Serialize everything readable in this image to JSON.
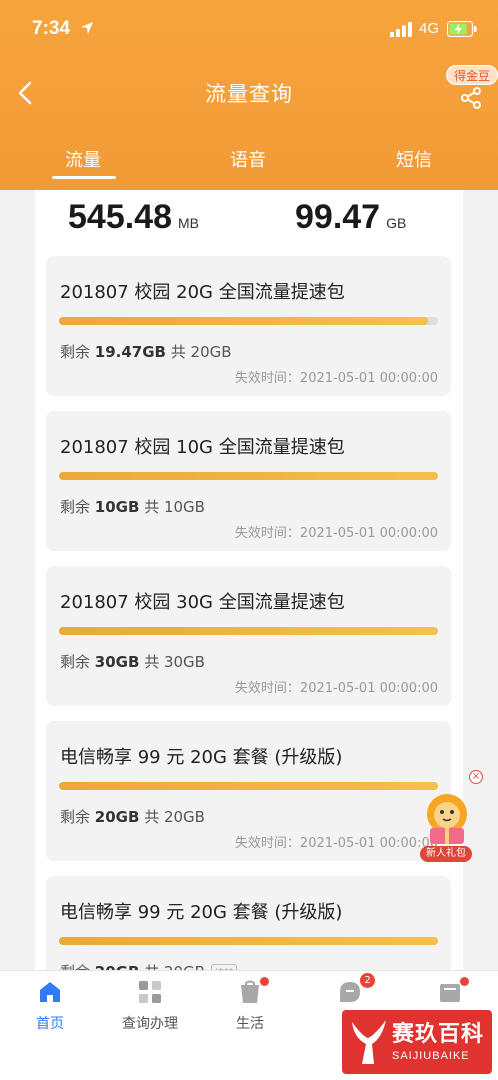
{
  "status_bar": {
    "time": "7:34",
    "network": "4G"
  },
  "nav": {
    "title": "流量查询",
    "badge": "得金豆"
  },
  "tabs": [
    {
      "label": "流量",
      "active": true
    },
    {
      "label": "语音",
      "active": false
    },
    {
      "label": "短信",
      "active": false
    }
  ],
  "totals": {
    "used": {
      "value": "545.48",
      "unit": "MB"
    },
    "remaining": {
      "value": "99.47",
      "unit": "GB"
    }
  },
  "packages": [
    {
      "name": "201807 校园 20G 全国流量提速包",
      "remain_prefix": "剩余",
      "remain": "19.47GB",
      "total": "共 20GB",
      "expire": "失效时间：2021-05-01 00:00:00",
      "progress": 0.9735
    },
    {
      "name": "201807 校园 10G 全国流量提速包",
      "remain_prefix": "剩余",
      "remain": "10GB",
      "total": "共 10GB",
      "expire": "失效时间：2021-05-01 00:00:00",
      "progress": 1.0
    },
    {
      "name": "201807 校园 30G 全国流量提速包",
      "remain_prefix": "剩余",
      "remain": "30GB",
      "total": "共 30GB",
      "expire": "失效时间：2021-05-01 00:00:00",
      "progress": 1.0
    },
    {
      "name": "电信畅享 99 元 20G 套餐 (升级版)",
      "remain_prefix": "剩余",
      "remain": "20GB",
      "total": "共 20GB",
      "expire": "失效时间：2021-05-01 00:00:00",
      "progress": 1.0
    },
    {
      "name": "电信畅享 99 元 20G 套餐 (升级版)",
      "remain_prefix": "剩余",
      "remain": "20GB",
      "total": "共 20GB",
      "tag": "结转",
      "progress": 1.0
    }
  ],
  "promo": {
    "label": "新人礼包"
  },
  "tabbar": [
    {
      "label": "首页",
      "active": true
    },
    {
      "label": "查询办理",
      "active": false
    },
    {
      "label": "生活",
      "active": false,
      "dot": true
    },
    {
      "label": "",
      "active": false,
      "count": "2"
    },
    {
      "label": "",
      "active": false,
      "dot": true
    }
  ],
  "watermark": {
    "title": "赛玖百科",
    "subtitle": "SAIJIUBAIKE"
  },
  "colors": {
    "header": "#f29b36",
    "progress": "#f0b442",
    "active_tab": "#2f7cf6"
  }
}
